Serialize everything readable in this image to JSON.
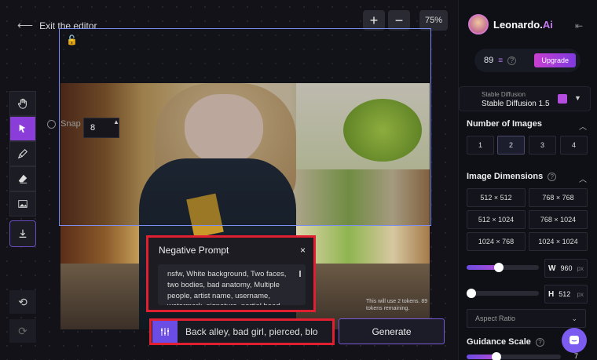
{
  "header": {
    "exit_label": "Exit the editor",
    "zoom_in": "+",
    "zoom_out": "−",
    "zoom_level": "75%"
  },
  "canvas": {
    "snap_label": "Snap",
    "snap_value": "8",
    "overlay_note": "This will use 2 tokens. 89 tokens remaining."
  },
  "negative_prompt": {
    "title": "Negative Prompt",
    "close": "×",
    "text": "nsfw, White background, Two faces, two bodies, bad anatomy, Multiple people, artist name, username, watermark, signature, partial head,"
  },
  "prompt": {
    "text": "Back alley, bad girl, pierced, blo",
    "generate_label": "Generate"
  },
  "sidebar": {
    "brand_name": "Leonardo.",
    "brand_suffix": "Ai",
    "tokens": "89",
    "upgrade_label": "Upgrade",
    "model_caption": "Stable Diffusion",
    "model_name": "Stable Diffusion 1.5",
    "num_images_title": "Number of Images",
    "num_images": [
      "1",
      "2",
      "3",
      "4"
    ],
    "num_images_selected": "2",
    "dimensions_title": "Image Dimensions",
    "dimensions": [
      "512 × 512",
      "768 × 768",
      "512 × 1024",
      "768 × 1024",
      "1024 × 768",
      "1024 × 1024"
    ],
    "width_key": "W",
    "width_value": "960",
    "height_key": "H",
    "height_value": "512",
    "unit": "px",
    "width_slider": 0.45,
    "height_slider": 0.0,
    "aspect_label": "Aspect Ratio",
    "guidance_title": "Guidance Scale",
    "guidance_value": "7"
  }
}
